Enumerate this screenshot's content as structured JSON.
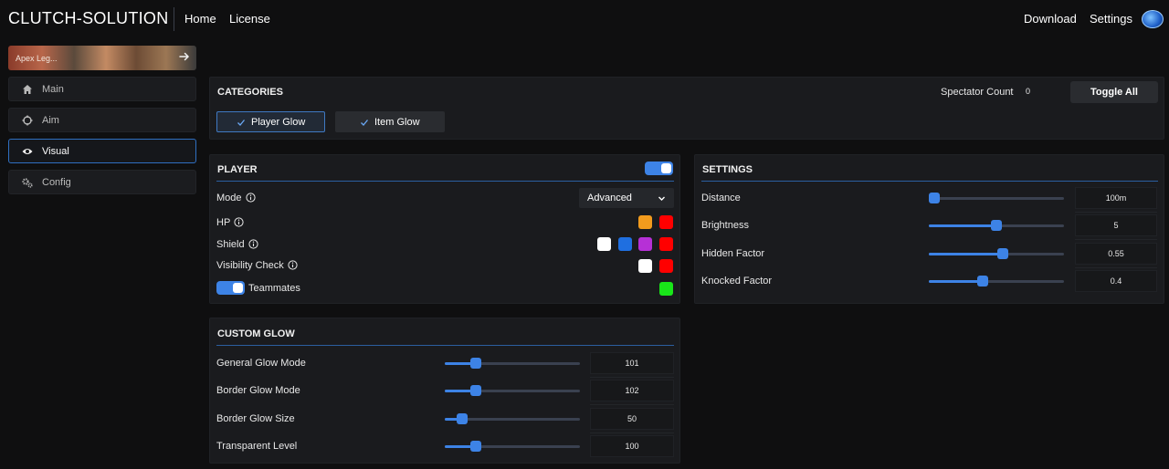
{
  "header": {
    "brand": "CLUTCH-SOLUTION",
    "nav_left": [
      "Home",
      "License"
    ],
    "nav_right": [
      "Download",
      "Settings"
    ],
    "avatar_icon": "globe-badge-icon"
  },
  "sidebar": {
    "game_card": {
      "label": "Apex Leg...",
      "icon": "arrow-right-icon"
    },
    "items": [
      {
        "label": "Main",
        "icon": "home-icon"
      },
      {
        "label": "Aim",
        "icon": "crosshair-icon"
      },
      {
        "label": "Visual",
        "icon": "eye-icon",
        "active": true
      },
      {
        "label": "Config",
        "icon": "gears-icon"
      }
    ]
  },
  "categories": {
    "title": "CATEGORIES",
    "spectator_label": "Spectator Count",
    "spectator_count": "0",
    "toggle_all": "Toggle All",
    "tabs": [
      {
        "label": "Player Glow",
        "selected": true
      },
      {
        "label": "Item Glow",
        "selected": false
      }
    ]
  },
  "player": {
    "title": "PLAYER",
    "enabled": true,
    "mode_label": "Mode",
    "mode_value": "Advanced",
    "hp_label": "HP",
    "hp_colors": [
      "#f29b1d",
      "#ff0000"
    ],
    "shield_label": "Shield",
    "shield_colors": [
      "#ffffff",
      "#1f6fe0",
      "#b630d6",
      "#ff0000"
    ],
    "visibility_label": "Visibility Check",
    "visibility_colors": [
      "#ffffff",
      "#ff0000"
    ],
    "teammates_label": "Teammates",
    "teammates_enabled": true,
    "teammates_color": "#19e619"
  },
  "settings": {
    "title": "SETTINGS",
    "rows": [
      {
        "label": "Distance",
        "value": "100m",
        "fraction": 0.04
      },
      {
        "label": "Brightness",
        "value": "5",
        "fraction": 0.5
      },
      {
        "label": "Hidden Factor",
        "value": "0.55",
        "fraction": 0.55
      },
      {
        "label": "Knocked Factor",
        "value": "0.4",
        "fraction": 0.4
      }
    ]
  },
  "custom_glow": {
    "title": "CUSTOM GLOW",
    "rows": [
      {
        "label": "General Glow Mode",
        "value": "101",
        "fraction": 0.23
      },
      {
        "label": "Border Glow Mode",
        "value": "102",
        "fraction": 0.23
      },
      {
        "label": "Border Glow Size",
        "value": "50",
        "fraction": 0.13
      },
      {
        "label": "Transparent Level",
        "value": "100",
        "fraction": 0.23
      }
    ]
  },
  "colors": {
    "accent": "#3d83e6",
    "background": "#0f0f10",
    "panel": "#1a1b1e"
  }
}
